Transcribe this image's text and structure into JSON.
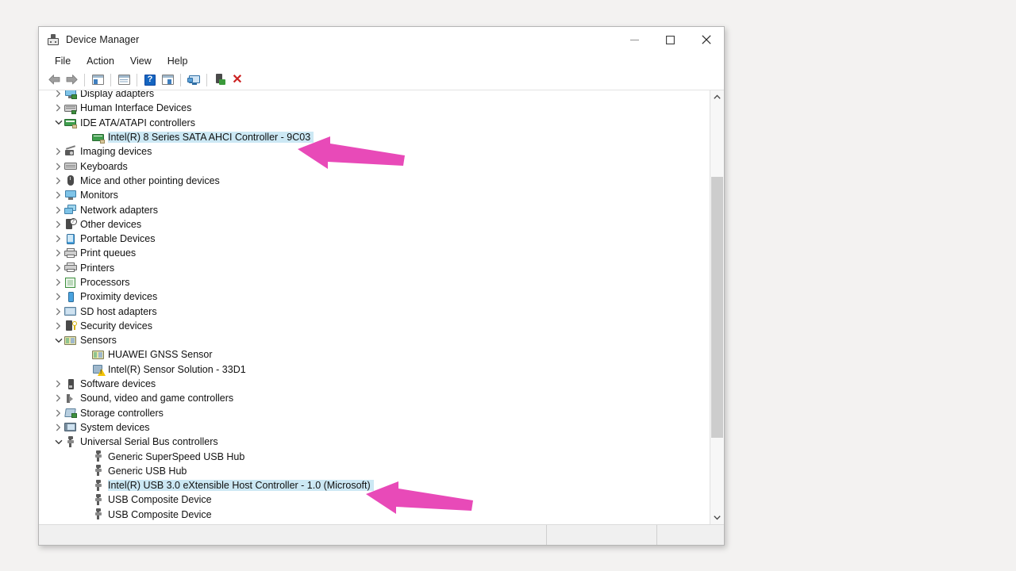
{
  "window": {
    "title": "Device Manager",
    "icon": "device-manager-icon",
    "controls": {
      "minimize": "—",
      "maximize": "□",
      "close": "✕"
    }
  },
  "menubar": {
    "items": [
      "File",
      "Action",
      "View",
      "Help"
    ]
  },
  "toolbar": {
    "items": [
      {
        "name": "back-icon",
        "label": "Back"
      },
      {
        "name": "forward-icon",
        "label": "Forward"
      },
      {
        "name": "show-hide-console-tree-icon",
        "label": "Show/Hide Console Tree"
      },
      {
        "name": "properties-icon",
        "label": "Properties"
      },
      {
        "name": "help-icon",
        "label": "Help"
      },
      {
        "name": "update-driver-icon",
        "label": "Update Driver"
      },
      {
        "name": "scan-for-hardware-changes-icon",
        "label": "Scan for hardware changes"
      },
      {
        "name": "enable-device-icon",
        "label": "Enable device"
      },
      {
        "name": "uninstall-device-icon",
        "label": "Uninstall device"
      }
    ]
  },
  "tree": {
    "rows": [
      {
        "label": "Display adapters",
        "level": 0,
        "expander": "collapsed",
        "icon": "display-adapter-icon",
        "selected": false
      },
      {
        "label": "Human Interface Devices",
        "level": 0,
        "expander": "collapsed",
        "icon": "hid-icon",
        "selected": false
      },
      {
        "label": "IDE ATA/ATAPI controllers",
        "level": 0,
        "expander": "expanded",
        "icon": "ide-controller-icon",
        "selected": false
      },
      {
        "label": "Intel(R) 8 Series SATA AHCI Controller - 9C03",
        "level": 1,
        "expander": "none",
        "icon": "ide-controller-icon",
        "selected": true
      },
      {
        "label": "Imaging devices",
        "level": 0,
        "expander": "collapsed",
        "icon": "imaging-device-icon",
        "selected": false
      },
      {
        "label": "Keyboards",
        "level": 0,
        "expander": "collapsed",
        "icon": "keyboard-icon",
        "selected": false
      },
      {
        "label": "Mice and other pointing devices",
        "level": 0,
        "expander": "collapsed",
        "icon": "mouse-icon",
        "selected": false
      },
      {
        "label": "Monitors",
        "level": 0,
        "expander": "collapsed",
        "icon": "monitor-icon",
        "selected": false
      },
      {
        "label": "Network adapters",
        "level": 0,
        "expander": "collapsed",
        "icon": "network-adapter-icon",
        "selected": false
      },
      {
        "label": "Other devices",
        "level": 0,
        "expander": "collapsed",
        "icon": "other-device-icon",
        "selected": false
      },
      {
        "label": "Portable Devices",
        "level": 0,
        "expander": "collapsed",
        "icon": "portable-device-icon",
        "selected": false
      },
      {
        "label": "Print queues",
        "level": 0,
        "expander": "collapsed",
        "icon": "printer-icon",
        "selected": false
      },
      {
        "label": "Printers",
        "level": 0,
        "expander": "collapsed",
        "icon": "printer-icon",
        "selected": false
      },
      {
        "label": "Processors",
        "level": 0,
        "expander": "collapsed",
        "icon": "processor-icon",
        "selected": false
      },
      {
        "label": "Proximity devices",
        "level": 0,
        "expander": "collapsed",
        "icon": "proximity-device-icon",
        "selected": false
      },
      {
        "label": "SD host adapters",
        "level": 0,
        "expander": "collapsed",
        "icon": "sd-host-adapter-icon",
        "selected": false
      },
      {
        "label": "Security devices",
        "level": 0,
        "expander": "collapsed",
        "icon": "security-device-icon",
        "selected": false
      },
      {
        "label": "Sensors",
        "level": 0,
        "expander": "expanded",
        "icon": "sensor-icon",
        "selected": false
      },
      {
        "label": "HUAWEI GNSS Sensor",
        "level": 1,
        "expander": "none",
        "icon": "sensor-icon",
        "selected": false
      },
      {
        "label": "Intel(R) Sensor Solution - 33D1",
        "level": 1,
        "expander": "none",
        "icon": "sensor-warning-icon",
        "selected": false
      },
      {
        "label": "Software devices",
        "level": 0,
        "expander": "collapsed",
        "icon": "software-device-icon",
        "selected": false
      },
      {
        "label": "Sound, video and game controllers",
        "level": 0,
        "expander": "collapsed",
        "icon": "sound-device-icon",
        "selected": false
      },
      {
        "label": "Storage controllers",
        "level": 0,
        "expander": "collapsed",
        "icon": "storage-controller-icon",
        "selected": false
      },
      {
        "label": "System devices",
        "level": 0,
        "expander": "collapsed",
        "icon": "system-device-icon",
        "selected": false
      },
      {
        "label": "Universal Serial Bus controllers",
        "level": 0,
        "expander": "expanded",
        "icon": "usb-icon",
        "selected": false
      },
      {
        "label": "Generic SuperSpeed USB Hub",
        "level": 1,
        "expander": "none",
        "icon": "usb-icon",
        "selected": false
      },
      {
        "label": "Generic USB Hub",
        "level": 1,
        "expander": "none",
        "icon": "usb-icon",
        "selected": false
      },
      {
        "label": "Intel(R) USB 3.0 eXtensible Host Controller - 1.0 (Microsoft)",
        "level": 1,
        "expander": "none",
        "icon": "usb-icon",
        "selected": true
      },
      {
        "label": "USB Composite Device",
        "level": 1,
        "expander": "none",
        "icon": "usb-icon",
        "selected": false
      },
      {
        "label": "USB Composite Device",
        "level": 1,
        "expander": "none",
        "icon": "usb-icon",
        "selected": false
      }
    ]
  },
  "scrollbar": {
    "up": "scroll-up-arrow",
    "down": "scroll-down-arrow",
    "thumb_top_pct": 18,
    "thumb_height_pct": 64
  },
  "statusbar": {
    "pane1": "",
    "pane2": "",
    "pane3": ""
  },
  "annotations": {
    "color": "#e84ab8",
    "arrows": [
      {
        "name": "arrow-pointing-sata-controller",
        "target": "Intel(R) 8 Series SATA AHCI Controller - 9C03"
      },
      {
        "name": "arrow-pointing-usb-host-controller",
        "target": "Intel(R) USB 3.0 eXtensible Host Controller - 1.0 (Microsoft)"
      }
    ]
  }
}
